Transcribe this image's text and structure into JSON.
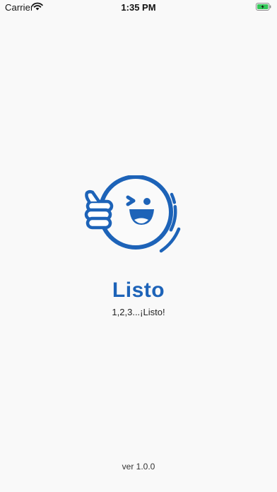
{
  "status_bar": {
    "carrier": "Carrier",
    "time": "1:35 PM",
    "wifi_icon": "wifi-icon",
    "battery_icon": "battery-charging-icon",
    "battery_color": "#34c759"
  },
  "splash": {
    "logo_icon": "winking-face-thumbs-up-icon",
    "app_name": "Listo",
    "tagline": "1,2,3...¡Listo!",
    "version": "ver 1.0.0",
    "brand_color": "#1d63b8"
  }
}
